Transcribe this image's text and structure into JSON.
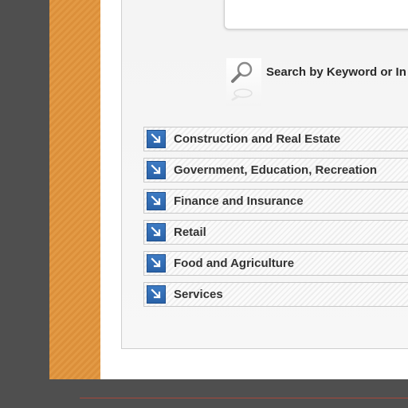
{
  "search": {
    "label": "Search by Keyword or In"
  },
  "categories": [
    {
      "label": "Construction and Real Estate",
      "icon": "arrow-down-right-icon"
    },
    {
      "label": "Government, Education, Recreation",
      "icon": "arrow-down-right-icon"
    },
    {
      "label": "Finance and Insurance",
      "icon": "arrow-down-right-icon"
    },
    {
      "label": "Retail",
      "icon": "arrow-down-right-icon"
    },
    {
      "label": "Food and Agriculture",
      "icon": "arrow-down-right-icon"
    },
    {
      "label": "Services",
      "icon": "arrow-down-right-icon"
    }
  ],
  "colors": {
    "background": "#4f4f4f",
    "orange_strip": "#e39a45",
    "category_icon": "#3d7bc4",
    "text": "#333333",
    "bottom_rule": "#a5473a"
  }
}
